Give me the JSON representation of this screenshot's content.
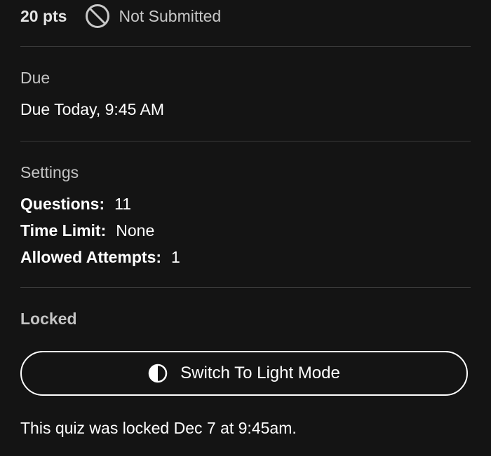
{
  "header": {
    "points": "20 pts",
    "status": "Not Submitted",
    "status_icon": "not-submitted-icon"
  },
  "due": {
    "label": "Due",
    "value": "Due Today, 9:45 AM"
  },
  "settings": {
    "label": "Settings",
    "rows": [
      {
        "key": "Questions:",
        "value": "11"
      },
      {
        "key": "Time Limit:",
        "value": "None"
      },
      {
        "key": "Allowed Attempts:",
        "value": "1"
      }
    ]
  },
  "locked": {
    "label": "Locked",
    "message": "This quiz was locked Dec 7 at 9:45am."
  },
  "mode_button": {
    "label": "Switch To Light Mode",
    "icon": "half-circle-contrast-icon"
  },
  "colors": {
    "background": "#141414",
    "text": "#ffffff",
    "muted": "#c4c4c4",
    "divider": "#3a3a3a"
  }
}
